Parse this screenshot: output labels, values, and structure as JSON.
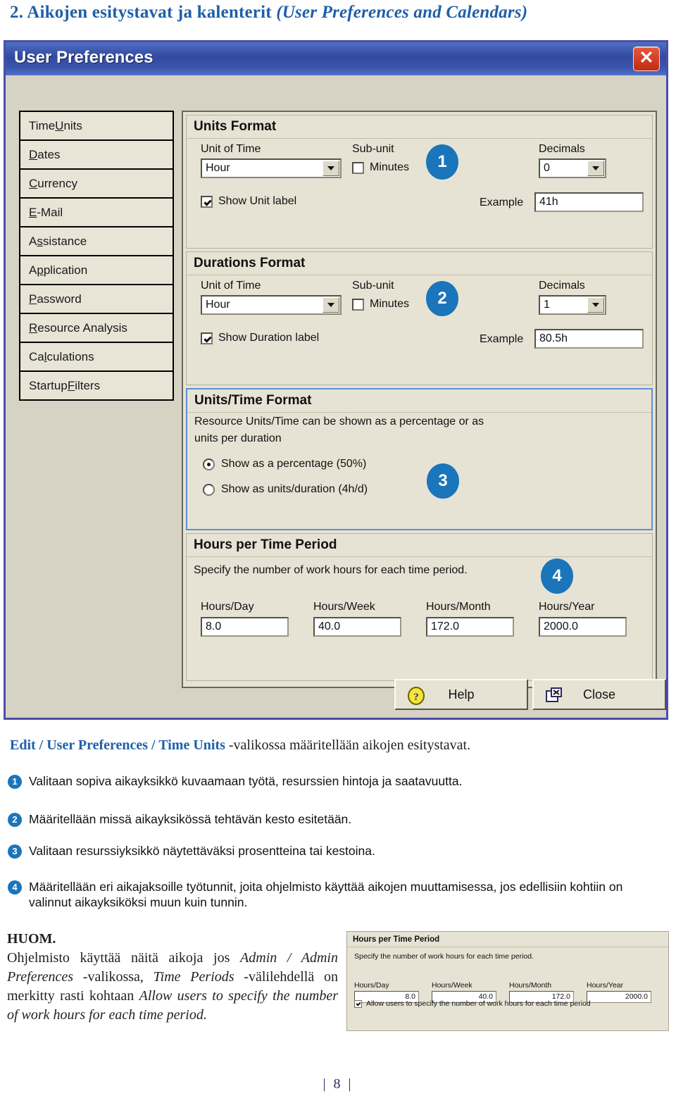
{
  "page": {
    "heading_plain": "2. Aikojen esitystavat ja kalenterit ",
    "heading_italic": "(User Preferences and Calendars)",
    "footer": "| 8 |"
  },
  "dialog": {
    "title": "User Preferences",
    "close_icon": "close-x-icon",
    "sidebar": {
      "items": [
        {
          "pre": "Time ",
          "key": "U",
          "post": "nits"
        },
        {
          "pre": "",
          "key": "D",
          "post": "ates"
        },
        {
          "pre": "",
          "key": "C",
          "post": "urrency"
        },
        {
          "pre": "",
          "key": "E",
          "post": "-Mail"
        },
        {
          "pre": "A",
          "key": "s",
          "post": "sistance"
        },
        {
          "pre": "A",
          "key": "p",
          "post": "plication"
        },
        {
          "pre": "",
          "key": "P",
          "post": "assword"
        },
        {
          "pre": "",
          "key": "R",
          "post": "esource Analysis"
        },
        {
          "pre": "Ca",
          "key": "l",
          "post": "culations"
        },
        {
          "pre": "Startup ",
          "key": "F",
          "post": "ilters"
        }
      ]
    },
    "units_format": {
      "title": "Units Format",
      "unit_of_time_label": "Unit of Time",
      "unit_of_time_value": "Hour",
      "sub_unit_label": "Sub-unit",
      "sub_unit_checkbox_label": "Minutes",
      "sub_unit_checked": false,
      "decimals_label": "Decimals",
      "decimals_value": "0",
      "show_label_checkbox": "Show Unit label",
      "show_label_checked": true,
      "example_label": "Example",
      "example_value": "41h",
      "badge": "1"
    },
    "durations_format": {
      "title": "Durations Format",
      "unit_of_time_label": "Unit of Time",
      "unit_of_time_value": "Hour",
      "sub_unit_label": "Sub-unit",
      "sub_unit_checkbox_label": "Minutes",
      "sub_unit_checked": false,
      "decimals_label": "Decimals",
      "decimals_value": "1",
      "show_label_checkbox": "Show Duration label",
      "show_label_checked": true,
      "example_label": "Example",
      "example_value": "80.5h",
      "badge": "2"
    },
    "units_time_format": {
      "title": "Units/Time Format",
      "description_line1": "Resource Units/Time can be shown as a percentage or as",
      "description_line2": "units per duration",
      "option_percentage": "Show as a percentage (50%)",
      "option_units_duration": "Show as units/duration (4h/d)",
      "selected": "percentage",
      "badge": "3"
    },
    "hours_per_time_period": {
      "title": "Hours per Time Period",
      "description": "Specify the number of work hours for each time period.",
      "badge": "4",
      "fields": [
        {
          "label": "Hours/Day",
          "value": "8.0"
        },
        {
          "label": "Hours/Week",
          "value": "40.0"
        },
        {
          "label": "Hours/Month",
          "value": "172.0"
        },
        {
          "label": "Hours/Year",
          "value": "2000.0"
        }
      ]
    },
    "footer_buttons": {
      "help": "Help",
      "close": "Close"
    }
  },
  "caption": {
    "bold_part": "Edit / User Preferences / Time Units",
    "rest": " -valikossa määritellään aikojen esitystavat."
  },
  "notes": [
    {
      "num": "1",
      "text": "Valitaan sopiva aikayksikkö kuvaamaan työtä, resurssien hintoja ja saatavuutta."
    },
    {
      "num": "2",
      "text": "Määritellään missä aikayksikössä tehtävän kesto esitetään."
    },
    {
      "num": "3",
      "text": "Valitaan resurssiyksikkö näytettäväksi prosentteina tai kestoina."
    },
    {
      "num": "4",
      "text": "Määritellään eri aikajaksoille työtunnit, joita ohjelmisto käyttää aikojen muuttamisessa, jos edellisiin kohtiin on valinnut aikayksiköksi muun kuin tunnin."
    }
  ],
  "huom": {
    "heading": "HUOM.",
    "t1": "Ohjelmisto käyttää näitä aikoja jos ",
    "i1": "Admin / Admin Preferences",
    "t2": " -valikossa, ",
    "i2": "Time Periods",
    "t3": " -välilehdellä on merkitty rasti kohtaan  ",
    "i3": "Allow users to specify the number of work hours for each time period."
  },
  "inset": {
    "title": "Hours per Time Period",
    "description": "Specify the number of work hours for each time period.",
    "fields": [
      {
        "label": "Hours/Day",
        "value": "8.0"
      },
      {
        "label": "Hours/Week",
        "value": "40.0"
      },
      {
        "label": "Hours/Month",
        "value": "172.0"
      },
      {
        "label": "Hours/Year",
        "value": "2000.0"
      }
    ],
    "allow_checkbox_label": "Allow users to specify the number of work hours for each time period",
    "allow_checked": true
  },
  "colors": {
    "heading_blue": "#1f5fa9",
    "badge_blue": "#1a75bb",
    "titlebar_blue": "#32499f",
    "dialog_face": "#e6e3d4"
  }
}
